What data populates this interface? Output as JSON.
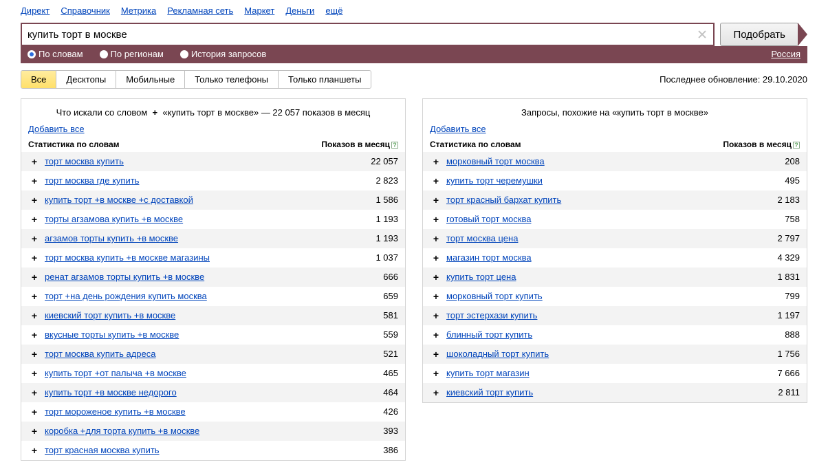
{
  "top_nav": [
    "Директ",
    "Справочник",
    "Метрика",
    "Рекламная сеть",
    "Маркет",
    "Деньги",
    "ещё"
  ],
  "search": {
    "value": "купить торт в москве",
    "submit": "Подобрать"
  },
  "filter": {
    "by_words": "По словам",
    "by_regions": "По регионам",
    "history": "История запросов",
    "region": "Россия"
  },
  "tabs": [
    "Все",
    "Десктопы",
    "Мобильные",
    "Только телефоны",
    "Только планшеты"
  ],
  "update_label": "Последнее обновление: 29.10.2020",
  "left_panel": {
    "title_prefix": "Что искали со словом",
    "plus": "+",
    "quoted": "«купить торт в москве»",
    "title_suffix": "— 22 057 показов в месяц",
    "add_all": "Добавить все",
    "stats_label": "Статистика по словам",
    "count_label": "Показов в месяц",
    "rows": [
      {
        "kw": "торт москва купить",
        "cnt": "22 057"
      },
      {
        "kw": "торт москва где купить",
        "cnt": "2 823"
      },
      {
        "kw": "купить торт +в москве +с доставкой",
        "cnt": "1 586"
      },
      {
        "kw": "торты агзамова купить +в москве",
        "cnt": "1 193"
      },
      {
        "kw": "агзамов торты купить +в москве",
        "cnt": "1 193"
      },
      {
        "kw": "торт москва купить +в москве магазины",
        "cnt": "1 037"
      },
      {
        "kw": "ренат агзамов торты купить +в москве",
        "cnt": "666"
      },
      {
        "kw": "торт +на день рождения купить москва",
        "cnt": "659"
      },
      {
        "kw": "киевский торт купить +в москве",
        "cnt": "581"
      },
      {
        "kw": "вкусные торты купить +в москве",
        "cnt": "559"
      },
      {
        "kw": "торт москва купить адреса",
        "cnt": "521"
      },
      {
        "kw": "купить торт +от палыча +в москве",
        "cnt": "465"
      },
      {
        "kw": "купить торт +в москве недорого",
        "cnt": "464"
      },
      {
        "kw": "торт мороженое купить +в москве",
        "cnt": "426"
      },
      {
        "kw": "коробка +для торта купить +в москве",
        "cnt": "393"
      },
      {
        "kw": "торт красная москва купить",
        "cnt": "386"
      }
    ]
  },
  "right_panel": {
    "title": "Запросы, похожие на «купить торт в москве»",
    "add_all": "Добавить все",
    "stats_label": "Статистика по словам",
    "count_label": "Показов в месяц",
    "rows": [
      {
        "kw": "морковный торт москва",
        "cnt": "208"
      },
      {
        "kw": "купить торт черемушки",
        "cnt": "495"
      },
      {
        "kw": "торт красный бархат купить",
        "cnt": "2 183"
      },
      {
        "kw": "готовый торт москва",
        "cnt": "758"
      },
      {
        "kw": "торт москва цена",
        "cnt": "2 797"
      },
      {
        "kw": "магазин торт москва",
        "cnt": "4 329"
      },
      {
        "kw": "купить торт цена",
        "cnt": "1 831"
      },
      {
        "kw": "морковный торт купить",
        "cnt": "799"
      },
      {
        "kw": "торт эстерхази купить",
        "cnt": "1 197"
      },
      {
        "kw": "блинный торт купить",
        "cnt": "888"
      },
      {
        "kw": "шоколадный торт купить",
        "cnt": "1 756"
      },
      {
        "kw": "купить торт магазин",
        "cnt": "7 666"
      },
      {
        "kw": "киевский торт купить",
        "cnt": "2 811"
      }
    ]
  }
}
